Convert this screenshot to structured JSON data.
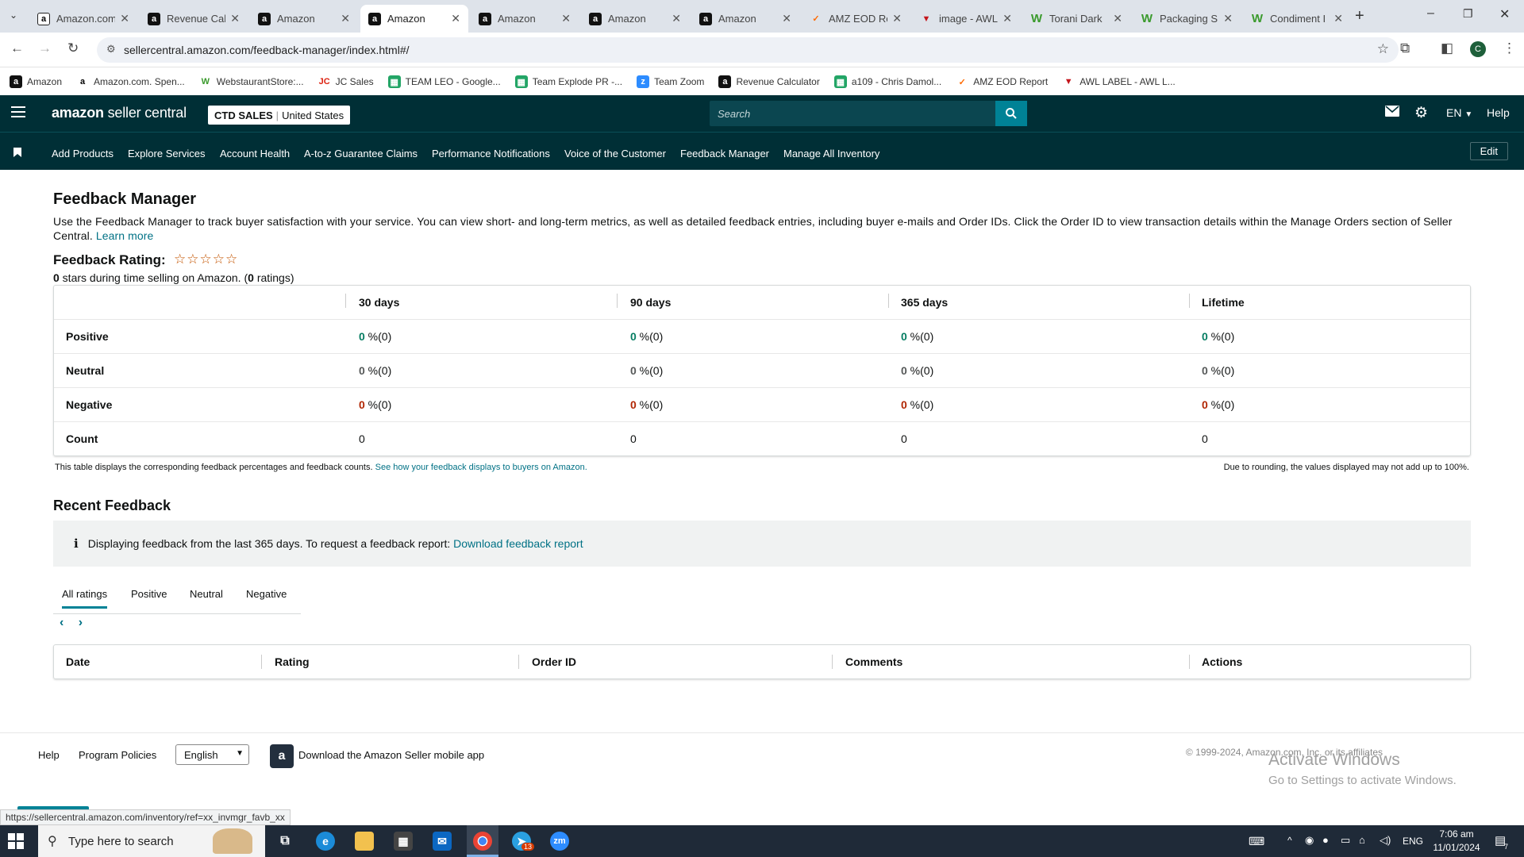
{
  "browser": {
    "tabs": [
      {
        "title": "Amazon.com",
        "favicon": "amazon-a"
      },
      {
        "title": "Revenue Cal",
        "favicon": "amazon-a-box"
      },
      {
        "title": "Amazon",
        "favicon": "amazon-a-box"
      },
      {
        "title": "Amazon",
        "favicon": "amazon-a-box",
        "active": true
      },
      {
        "title": "Amazon",
        "favicon": "amazon-a-box"
      },
      {
        "title": "Amazon",
        "favicon": "amazon-a-box"
      },
      {
        "title": "Amazon",
        "favicon": "amazon-a-box"
      },
      {
        "title": "AMZ EOD Re",
        "favicon": "amz-eod"
      },
      {
        "title": "image - AWL",
        "favicon": "awl-v"
      },
      {
        "title": "Torani Dark",
        "favicon": "webstaurant-w"
      },
      {
        "title": "Packaging S",
        "favicon": "webstaurant-w"
      },
      {
        "title": "Condiment I",
        "favicon": "webstaurant-w"
      }
    ],
    "url": "sellercentral.amazon.com/feedback-manager/index.html#/",
    "profile_initial": "C",
    "bookmarks": [
      {
        "label": "Amazon",
        "icon": "amazon-box-icon"
      },
      {
        "label": "Amazon.com. Spen...",
        "icon": "amazon-a-icon"
      },
      {
        "label": "WebstaurantStore:...",
        "icon": "webstaurant-icon"
      },
      {
        "label": "JC Sales",
        "icon": "jc-icon"
      },
      {
        "label": "TEAM LEO - Google...",
        "icon": "sheets-icon"
      },
      {
        "label": "Team Explode PR -...",
        "icon": "sheets-icon"
      },
      {
        "label": "Team Zoom",
        "icon": "zoom-icon"
      },
      {
        "label": "Revenue Calculator",
        "icon": "amazon-box-icon"
      },
      {
        "label": "a109 - Chris Damol...",
        "icon": "sheets-icon"
      },
      {
        "label": "AMZ EOD Report",
        "icon": "amz-eod-icon"
      },
      {
        "label": "AWL LABEL - AWL L...",
        "icon": "awl-icon"
      }
    ]
  },
  "header": {
    "logo_bold": "amazon",
    "logo_rest": " seller central",
    "account_name": "CTD SALES",
    "account_region": "United States",
    "search_placeholder": "Search",
    "language": "EN",
    "help": "Help"
  },
  "nav": {
    "links": [
      "Add Products",
      "Explore Services",
      "Account Health",
      "A-to-z Guarantee Claims",
      "Performance Notifications",
      "Voice of the Customer",
      "Feedback Manager",
      "Manage All Inventory"
    ],
    "edit": "Edit"
  },
  "page": {
    "title": "Feedback Manager",
    "intro": "Use the Feedback Manager to track buyer satisfaction with your service. You can view short- and long-term metrics, as well as detailed feedback entries, including buyer e-mails and Order IDs. Click the Order ID to view transaction details within the Manage Orders section of Seller Central.",
    "learn_more": "Learn more",
    "rating_label": "Feedback Rating:",
    "stars_shown": 0,
    "stars_max": 5,
    "rating_sub_stars": "0",
    "rating_sub_text1": " stars during time selling on Amazon. (",
    "rating_sub_count": "0",
    "rating_sub_text2": " ratings)",
    "metrics": {
      "columns": [
        "30 days",
        "90 days",
        "365 days",
        "Lifetime"
      ],
      "rows": [
        {
          "label": "Positive",
          "values": [
            "0",
            "0",
            "0",
            "0"
          ],
          "suffix": " %(0)"
        },
        {
          "label": "Neutral",
          "values": [
            "0",
            "0",
            "0",
            "0"
          ],
          "suffix": " %(0)"
        },
        {
          "label": "Negative",
          "values": [
            "0",
            "0",
            "0",
            "0"
          ],
          "suffix": " %(0)"
        },
        {
          "label": "Count",
          "values": [
            "0",
            "0",
            "0",
            "0"
          ],
          "suffix": ""
        }
      ]
    },
    "table_note": "This table displays the corresponding feedback percentages and feedback counts.",
    "table_note_link": "See how your feedback displays to buyers on Amazon.",
    "rounding_note": "Due to rounding, the values displayed may not add up to 100%.",
    "recent_title": "Recent Feedback",
    "info_text": "Displaying feedback from the last 365 days. To request a feedback report:",
    "info_link": "Download feedback report",
    "filter_tabs": [
      "All ratings",
      "Positive",
      "Neutral",
      "Negative"
    ],
    "feedback_columns": [
      "Date",
      "Rating",
      "Order ID",
      "Comments",
      "Actions"
    ]
  },
  "footer": {
    "help": "Help",
    "policies": "Program Policies",
    "language": "English",
    "app": "Download the Amazon Seller mobile app",
    "copyright": "© 1999-2024, Amazon.com, Inc. or its affiliates",
    "activate1": "Activate Windows",
    "activate2": "Go to Settings to activate Windows."
  },
  "status_url": "https://sellercentral.amazon.com/inventory/ref=xx_invmgr_favb_xx",
  "taskbar": {
    "search_placeholder": "Type here to search",
    "language": "ENG",
    "time": "7:06 am",
    "date": "11/01/2024",
    "mail_badge": "13",
    "notifications": "7"
  },
  "colors": {
    "header_bg": "#002f36",
    "accent": "#008296",
    "positive": "#067d62",
    "negative": "#b12704",
    "link": "#007185"
  }
}
